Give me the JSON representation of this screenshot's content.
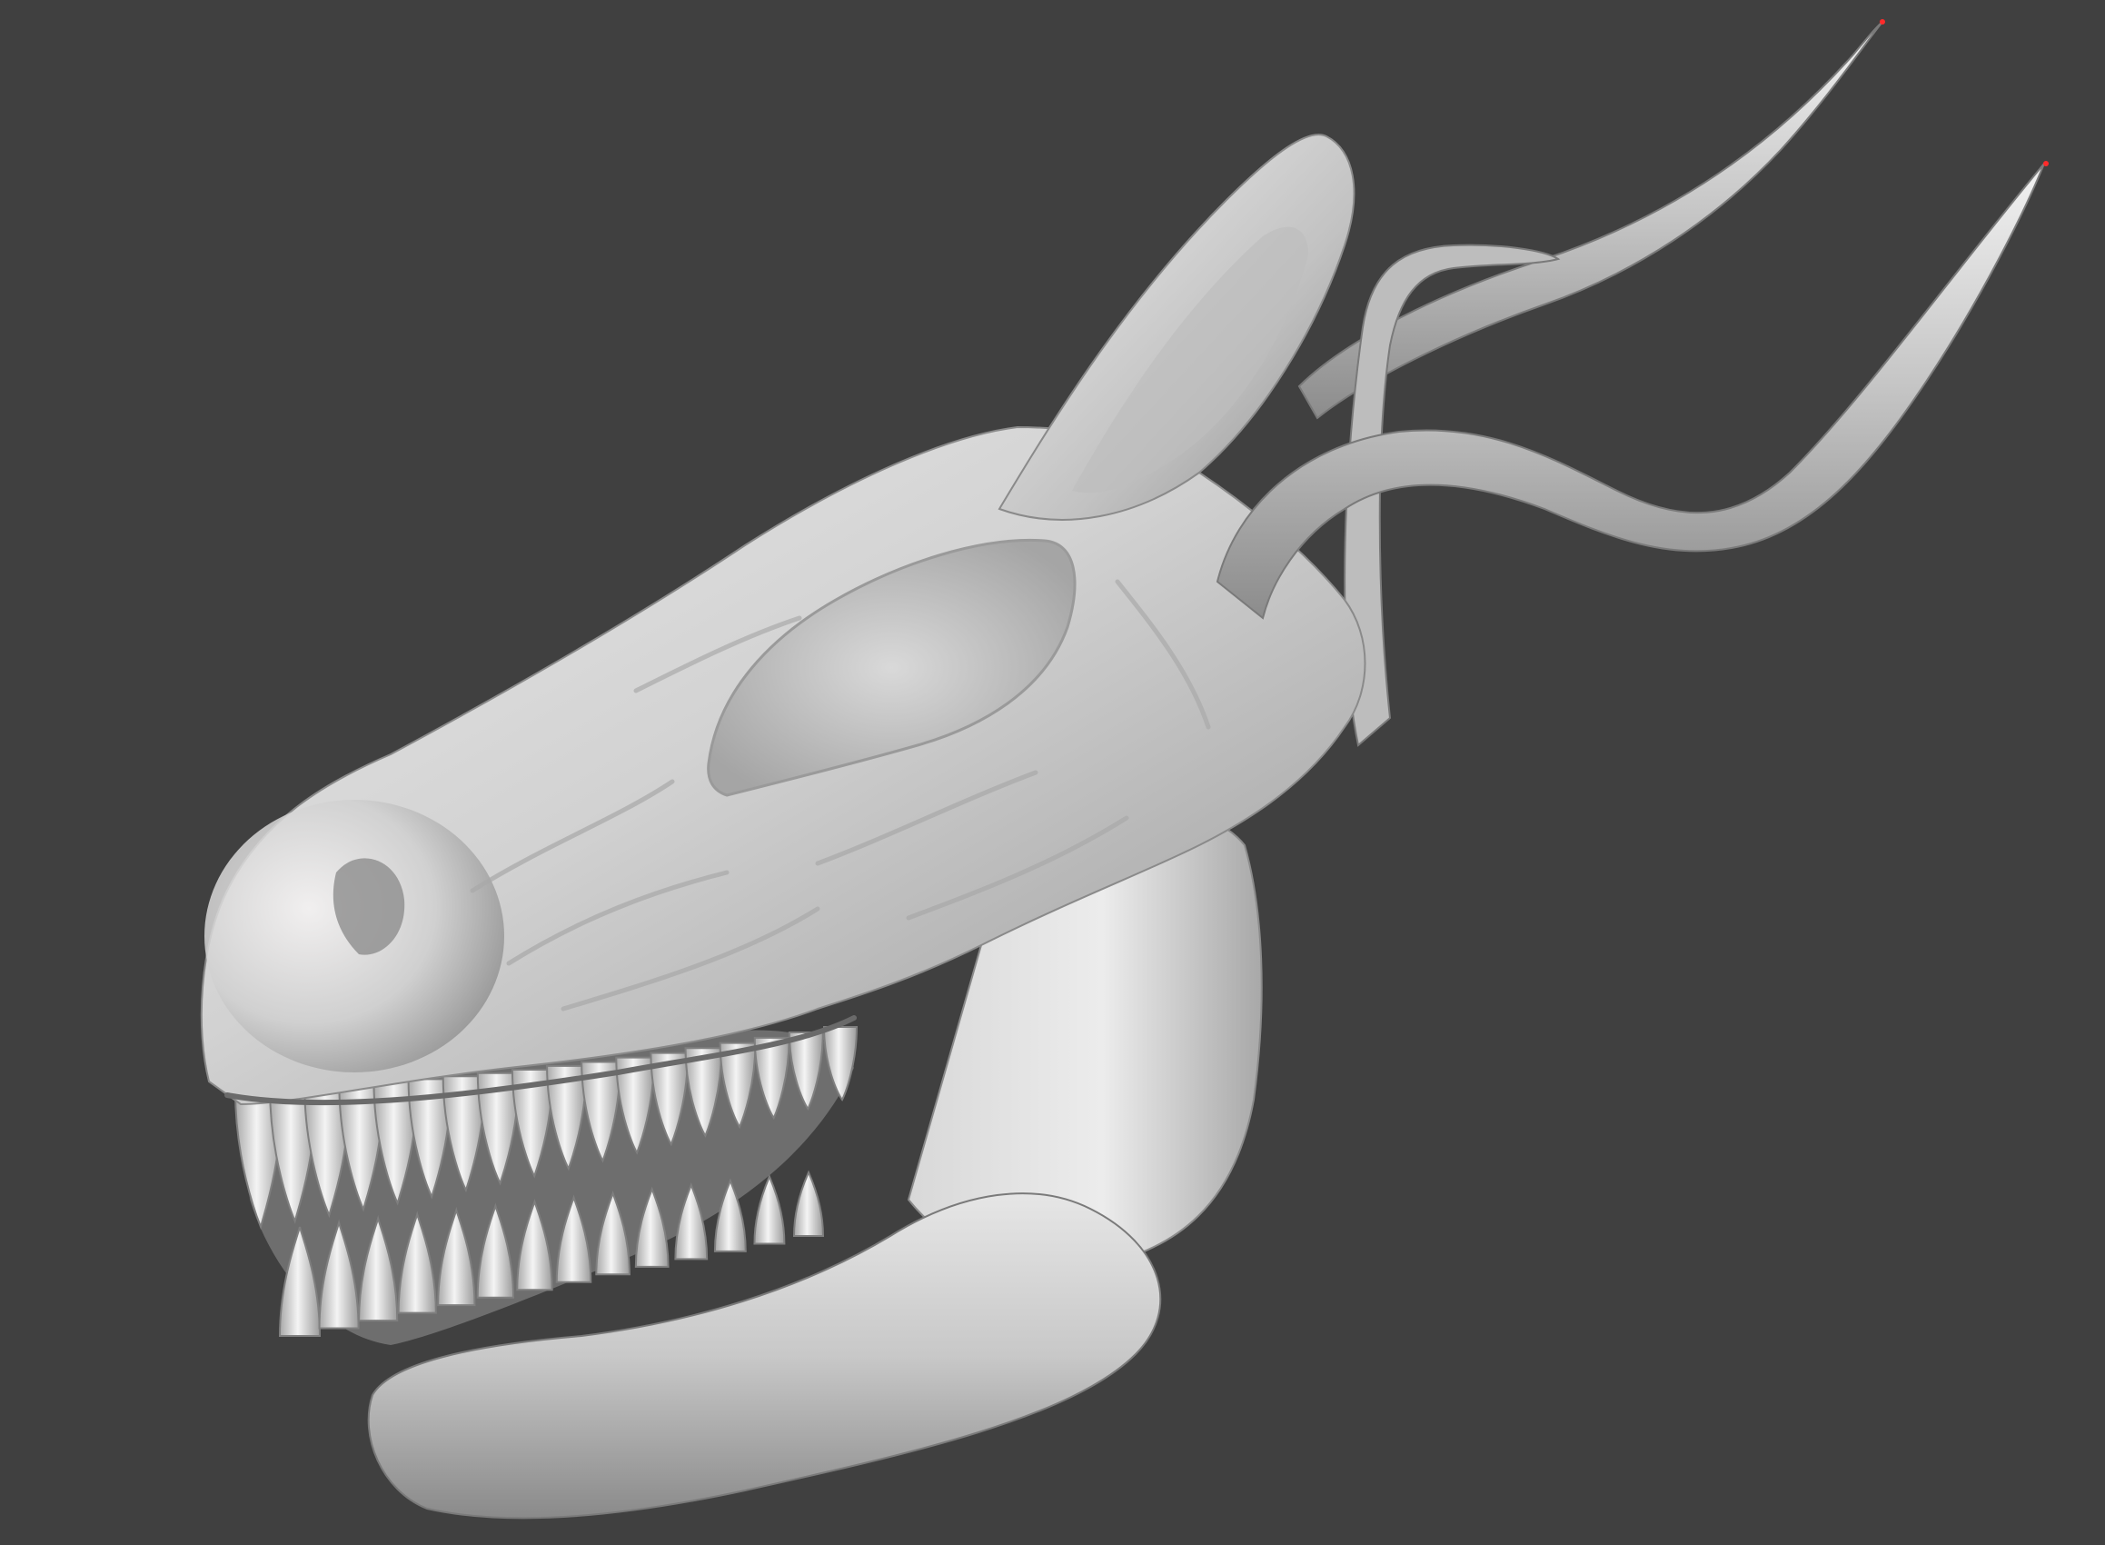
{
  "viewport": {
    "background": "#404040",
    "model": {
      "subject": "creature-head-sculpt",
      "material_light": "#f4f2f2",
      "material_mid": "#c9c9c9",
      "material_shadow": "#7d7d7d",
      "material_dark": "#5a5a5a",
      "marker_color": "#ff2a2a"
    }
  }
}
